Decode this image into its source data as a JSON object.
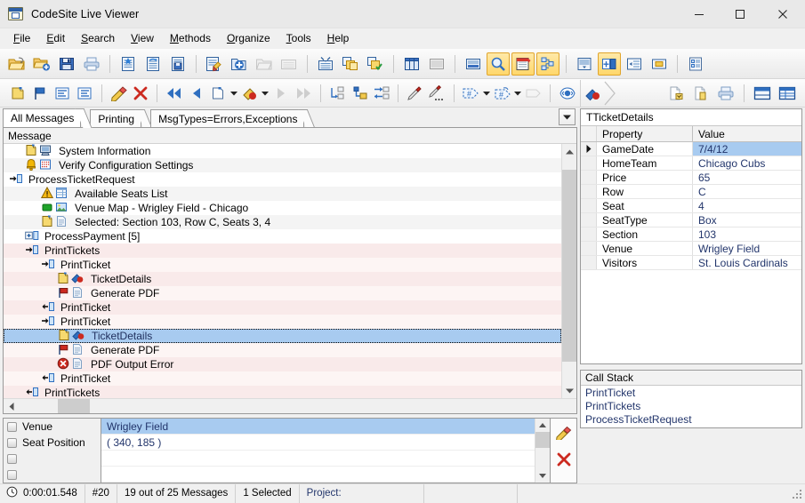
{
  "window": {
    "title": "CodeSite Live Viewer",
    "icon": "codesite-app-icon",
    "minimize": "minimize",
    "maximize": "maximize",
    "close": "close"
  },
  "menu": {
    "items": [
      {
        "label": "File",
        "accel": "F"
      },
      {
        "label": "Edit",
        "accel": "E"
      },
      {
        "label": "Search",
        "accel": "S"
      },
      {
        "label": "View",
        "accel": "V"
      },
      {
        "label": "Methods",
        "accel": "M"
      },
      {
        "label": "Organize",
        "accel": "O"
      },
      {
        "label": "Tools",
        "accel": "T"
      },
      {
        "label": "Help",
        "accel": "H"
      }
    ]
  },
  "toolbar_main": {
    "buttons": [
      {
        "name": "open-folder-icon",
        "pressed": false
      },
      {
        "name": "open-folder-add-icon",
        "pressed": false
      },
      {
        "name": "save-icon",
        "pressed": false
      },
      {
        "name": "print-icon",
        "pressed": false
      },
      {
        "name": "clipboard-new-icon",
        "pressed": false
      },
      {
        "name": "clipboard-refresh-icon",
        "pressed": false
      },
      {
        "name": "clipboard-save-icon",
        "pressed": false
      },
      {
        "name": "clear-messages-icon",
        "pressed": false
      },
      {
        "name": "add-viewer-icon",
        "pressed": false
      },
      {
        "name": "folder-open-gray-icon",
        "pressed": false
      },
      {
        "name": "folder-closed-gray-icon",
        "pressed": false
      },
      {
        "name": "collapse-all-icon",
        "pressed": false
      },
      {
        "name": "copy-messages-icon",
        "pressed": false
      },
      {
        "name": "check-messages-icon",
        "pressed": false
      },
      {
        "name": "columns-view-icon",
        "pressed": false
      },
      {
        "name": "list-view-icon",
        "pressed": false
      },
      {
        "name": "details-view-icon",
        "pressed": false
      },
      {
        "name": "search-icon",
        "pressed": true
      },
      {
        "name": "notes-icon",
        "pressed": true
      },
      {
        "name": "call-stack-icon",
        "pressed": true
      },
      {
        "name": "message-detail-icon",
        "pressed": false
      },
      {
        "name": "inspector-panel-icon",
        "pressed": true
      },
      {
        "name": "indent-panel-icon",
        "pressed": false
      },
      {
        "name": "window-panel-icon",
        "pressed": false
      },
      {
        "name": "properties-list-icon",
        "pressed": false
      }
    ]
  },
  "toolbar_messages": {
    "buttons": [
      {
        "name": "note-icon"
      },
      {
        "name": "flag-icon"
      },
      {
        "name": "checkmarks-list-icon"
      },
      {
        "name": "clear-list-icon"
      },
      {
        "name": "eraser-icon"
      },
      {
        "name": "delete-icon"
      },
      {
        "name": "first-message-icon"
      },
      {
        "name": "previous-message-icon"
      },
      {
        "name": "note-jump-icon"
      },
      {
        "name": "note-jump-dropdown-icon"
      },
      {
        "name": "bookmark-jump-icon"
      },
      {
        "name": "bookmark-jump-dropdown-icon"
      },
      {
        "name": "next-message-icon"
      },
      {
        "name": "last-message-icon"
      },
      {
        "name": "goto-child-icon"
      },
      {
        "name": "goto-parent-icon"
      },
      {
        "name": "goto-sibling-icon"
      },
      {
        "name": "marker-icon"
      },
      {
        "name": "marker-options-icon"
      },
      {
        "name": "tag-icon"
      },
      {
        "name": "tag-dropdown-icon"
      },
      {
        "name": "tag-add-icon"
      },
      {
        "name": "tag-add-dropdown-icon"
      },
      {
        "name": "blank-tag-icon"
      },
      {
        "name": "watch-icon"
      }
    ]
  },
  "tabs": {
    "items": [
      {
        "label": "All Messages",
        "active": true
      },
      {
        "label": "Printing",
        "active": false
      },
      {
        "label": "MsgTypes=Errors,Exceptions",
        "active": false
      }
    ],
    "dropdown": "tab-list-dropdown"
  },
  "messages": {
    "column_header": "Message",
    "rows": [
      {
        "text": "System Information",
        "indent": 1,
        "bg": "white",
        "icons": [
          "note-yellow-icon",
          "computer-icon"
        ],
        "selected": false
      },
      {
        "text": "Verify Configuration Settings",
        "indent": 1,
        "bg": "alt",
        "icons": [
          "bell-icon",
          "checklist-icon"
        ],
        "selected": false
      },
      {
        "text": "ProcessTicketRequest",
        "indent": 0,
        "bg": "white",
        "icons": [
          "enter-method-icon"
        ],
        "selected": false
      },
      {
        "text": "Available Seats List",
        "indent": 2,
        "bg": "alt",
        "icons": [
          "warning-icon",
          "table-icon"
        ],
        "selected": false
      },
      {
        "text": "Venue Map - Wrigley Field - Chicago",
        "indent": 2,
        "bg": "white",
        "icons": [
          "green-square-icon",
          "image-icon"
        ],
        "selected": false
      },
      {
        "text": "Selected: Section 103, Row C, Seats 3, 4",
        "indent": 2,
        "bg": "alt",
        "icons": [
          "note-yellow-icon",
          "document-icon"
        ],
        "selected": false
      },
      {
        "text": "ProcessPayment  [5]",
        "indent": 1,
        "bg": "white",
        "icons": [
          "expand-plus-icon"
        ],
        "selected": false
      },
      {
        "text": "PrintTickets",
        "indent": 1,
        "bg": "pink",
        "icons": [
          "enter-method-icon"
        ],
        "selected": false
      },
      {
        "text": "PrintTicket",
        "indent": 2,
        "bg": "pink-alt",
        "icons": [
          "enter-method-icon"
        ],
        "selected": false
      },
      {
        "text": "TicketDetails",
        "indent": 3,
        "bg": "pink",
        "icons": [
          "note-yellow-icon",
          "object-inspect-icon"
        ],
        "selected": false
      },
      {
        "text": "Generate PDF",
        "indent": 3,
        "bg": "pink-alt",
        "icons": [
          "flag-red-icon",
          "document-icon"
        ],
        "selected": false
      },
      {
        "text": "PrintTicket",
        "indent": 2,
        "bg": "pink",
        "icons": [
          "exit-method-icon"
        ],
        "selected": false
      },
      {
        "text": "PrintTicket",
        "indent": 2,
        "bg": "pink-alt",
        "icons": [
          "enter-method-icon"
        ],
        "selected": false
      },
      {
        "text": "TicketDetails",
        "indent": 3,
        "bg": "selected",
        "icons": [
          "note-yellow-icon",
          "object-inspect-icon"
        ],
        "selected": true
      },
      {
        "text": "Generate PDF",
        "indent": 3,
        "bg": "pink-alt",
        "icons": [
          "flag-red-icon",
          "document-icon"
        ],
        "selected": false
      },
      {
        "text": "PDF Output Error",
        "indent": 3,
        "bg": "pink",
        "icons": [
          "error-icon",
          "document-icon"
        ],
        "selected": false
      },
      {
        "text": "PrintTicket",
        "indent": 2,
        "bg": "pink-alt",
        "icons": [
          "exit-method-icon"
        ],
        "selected": false
      },
      {
        "text": "PrintTickets",
        "indent": 1,
        "bg": "pink",
        "icons": [
          "exit-method-icon"
        ],
        "selected": false
      }
    ]
  },
  "watches": {
    "rows": [
      {
        "name": "Venue",
        "value": "Wrigley Field",
        "selected": true
      },
      {
        "name": "Seat Position",
        "value": "( 340, 185 )",
        "selected": false
      },
      {
        "name": "",
        "value": "",
        "selected": false
      },
      {
        "name": "",
        "value": "",
        "selected": false
      }
    ],
    "tools": [
      {
        "name": "eraser-icon"
      },
      {
        "name": "delete-red-x-icon"
      }
    ]
  },
  "inspector": {
    "tab_icon": "object-inspect-icon",
    "object_name": "TTicketDetails",
    "toolbar_buttons": [
      {
        "name": "copy-to-file-icon"
      },
      {
        "name": "copy-page-icon"
      },
      {
        "name": "print-icon"
      },
      {
        "name": "split-view-icon"
      },
      {
        "name": "grid-view-icon"
      }
    ],
    "columns": [
      "Property",
      "Value"
    ],
    "rows": [
      {
        "property": "GameDate",
        "value": "7/4/12",
        "selected": true
      },
      {
        "property": "HomeTeam",
        "value": "Chicago Cubs",
        "selected": false
      },
      {
        "property": "Price",
        "value": "65",
        "selected": false
      },
      {
        "property": "Row",
        "value": "C",
        "selected": false
      },
      {
        "property": "Seat",
        "value": "4",
        "selected": false
      },
      {
        "property": "SeatType",
        "value": "Box",
        "selected": false
      },
      {
        "property": "Section",
        "value": "103",
        "selected": false
      },
      {
        "property": "Venue",
        "value": "Wrigley Field",
        "selected": false
      },
      {
        "property": "Visitors",
        "value": "St. Louis Cardinals",
        "selected": false
      }
    ]
  },
  "call_stack": {
    "title": "Call Stack",
    "frames": [
      "PrintTicket",
      "PrintTickets",
      "ProcessTicketRequest"
    ]
  },
  "status_bar": {
    "clock_icon": "clock-icon",
    "elapsed": "0:00:01.548",
    "message_number": "#20",
    "counts": "19 out of 25 Messages",
    "selection": "1 Selected",
    "project": "Project:"
  },
  "colors": {
    "accent_selection": "#a8cbf0",
    "value_text": "#22356b",
    "pink_row": "#f9eaea",
    "pink_row_alt": "#fdf5f4",
    "toolbar_active": "#ffd76b"
  }
}
